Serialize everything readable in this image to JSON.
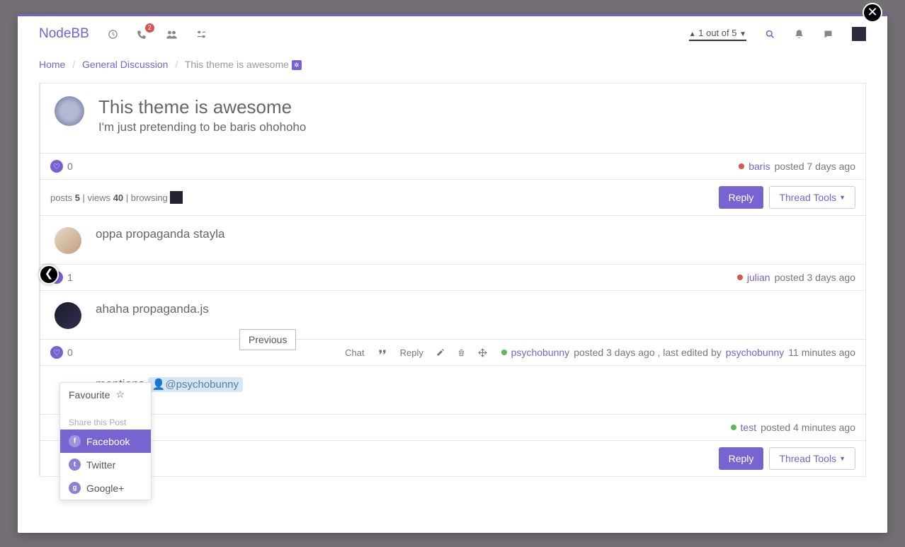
{
  "nav": {
    "brand": "NodeBB",
    "notif_badge": "2",
    "pager": "1 out of 5"
  },
  "breadcrumb": {
    "home": "Home",
    "category": "General Discussion",
    "topic": "This theme is awesome"
  },
  "op": {
    "title": "This theme is awesome",
    "body": "I'm just pretending to be baris ohohoho",
    "likes": "0",
    "author": "baris",
    "meta": "posted 7 days ago"
  },
  "stats": {
    "posts_label": "posts",
    "posts": "5",
    "views_label": "views",
    "views": "40",
    "browsing_label": "browsing"
  },
  "buttons": {
    "reply": "Reply",
    "thread_tools": "Thread Tools"
  },
  "post2": {
    "body": "oppa propaganda stayla",
    "likes": "1",
    "author": "julian",
    "meta": "posted 3 days ago"
  },
  "post3": {
    "body": "ahaha propaganda.js",
    "likes": "0",
    "chat": "Chat",
    "reply": "Reply",
    "author": "psychobunny",
    "meta1": "posted 3 days ago , last edited by",
    "editor": "psychobunny",
    "meta2": "11 minutes ago"
  },
  "tooltip": "Previous",
  "post4": {
    "pre": "mentions",
    "mention": "@psychobunny",
    "author": "test",
    "meta": "posted 4 minutes ago"
  },
  "dropdown": {
    "fav": "Favourite",
    "share_head": "Share this Post",
    "fb": "Facebook",
    "tw": "Twitter",
    "gp": "Google+"
  }
}
